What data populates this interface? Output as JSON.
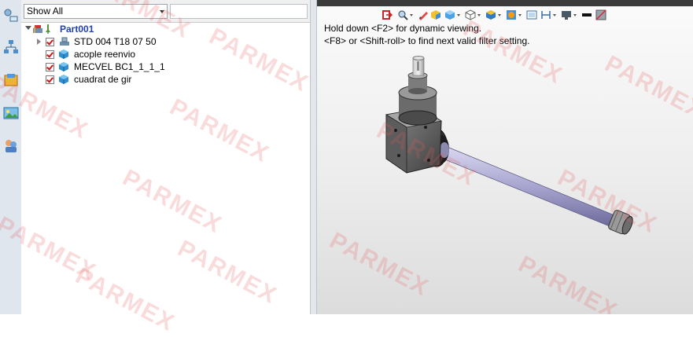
{
  "tree": {
    "filter": {
      "selected": "Show All",
      "search_placeholder": ""
    },
    "root": {
      "label": "Part001"
    },
    "items": [
      {
        "label": "STD 004 T18 07 50",
        "kind": "assembly"
      },
      {
        "label": "acople reenvio",
        "kind": "part"
      },
      {
        "label": "MECVEL BC1_1_1_1",
        "kind": "part"
      },
      {
        "label": "cuadrat de gir",
        "kind": "part"
      }
    ]
  },
  "viewport": {
    "hint_line1": "Hold down <F2> for dynamic viewing.",
    "hint_line2": "<F8> or <Shift-roll> to find next valid filter setting."
  },
  "watermark": {
    "text": "PARMEX",
    "color": "#e85a5a"
  },
  "icons": {
    "left_toolbar": [
      "feature-manager-icon",
      "configuration-icon",
      "property-icon",
      "display-manager-icon",
      "appearance-icon"
    ],
    "view_toolbar": [
      "exit-icon",
      "zoom-icon",
      "sketch-icon",
      "section-view-icon",
      "view-orientation-icon",
      "display-style-icon",
      "hide-show-icon",
      "edit-appearance-icon",
      "apply-scene-icon",
      "view-settings-icon",
      "monitor-icon",
      "line-icon",
      "split-icon"
    ]
  }
}
